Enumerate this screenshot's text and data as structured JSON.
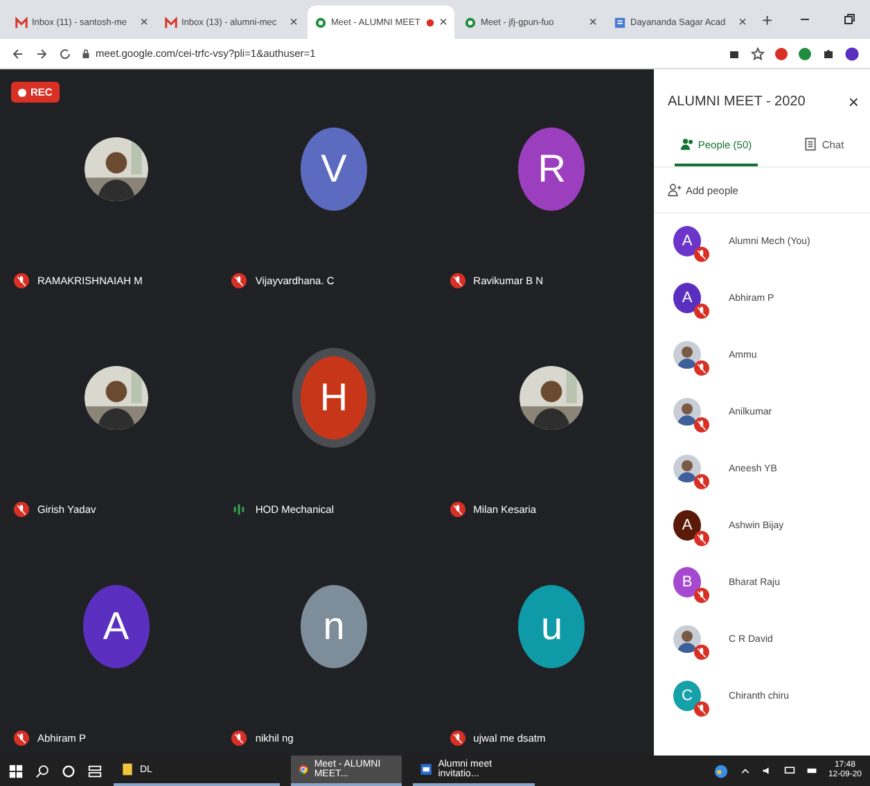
{
  "browser": {
    "tabs": [
      {
        "title": "Inbox (11) - santosh-me",
        "kind": "mail",
        "selected": false,
        "recording": false,
        "close": "×"
      },
      {
        "title": "Inbox (13) - alumni-mec",
        "kind": "mail",
        "selected": false,
        "recording": false,
        "close": "×"
      },
      {
        "title": "Meet - ALUMNI MEET",
        "kind": "meet",
        "selected": true,
        "recording": true,
        "close": "×"
      },
      {
        "title": "Meet - jfj-gpun-fuo",
        "kind": "meet",
        "selected": false,
        "recording": false,
        "close": "×"
      },
      {
        "title": "Dayananda Sagar Acad",
        "kind": "doc",
        "selected": false,
        "recording": false,
        "close": "×"
      }
    ],
    "new_tab": "+",
    "url": "meet.google.com/cei-trfc-vsy?pli=1&authuser=1"
  },
  "meeting": {
    "rec_label": "REC",
    "tiles": [
      {
        "name": "RAMAKRISHNAIAH M",
        "muted": true
      },
      {
        "name": "Vijayvardhana. C",
        "kind": "letter",
        "letter": "V",
        "color": "#5c6bc0",
        "muted": true
      },
      {
        "name": "Ravikumar B N",
        "kind": "letter",
        "letter": "R",
        "color": "#9c3fbf",
        "muted": true
      },
      {
        "name": "Girish Yadav",
        "muted": true
      },
      {
        "name": "HOD Mechanical",
        "kind": "letter",
        "letter": "H",
        "color": "#c8361a",
        "muted": false
      },
      {
        "name": "Milan Kesaria",
        "muted": true
      },
      {
        "name": "Abhiram P",
        "kind": "letter",
        "letter": "A",
        "color": "#5a2fc0",
        "muted": true
      },
      {
        "name": "nikhil ng",
        "kind": "letter",
        "letter": "n",
        "color": "#7d8d99",
        "muted": true
      },
      {
        "name": "ujwal me dsatm",
        "kind": "letter",
        "letter": "u",
        "color": "#0f9aa8",
        "muted": true
      }
    ]
  },
  "panel": {
    "title": "ALUMNI MEET - 2020",
    "close": "×",
    "tabs": [
      {
        "label": "People (50)",
        "kind": "people",
        "selected": true
      },
      {
        "label": "Chat",
        "kind": "chat",
        "selected": false
      }
    ],
    "add_people": "Add people",
    "people": [
      {
        "name": "Alumni Mech (You)",
        "kind": "letter",
        "letter": "A",
        "color": "#6a35c8"
      },
      {
        "name": "Abhiram P",
        "kind": "letter",
        "letter": "A",
        "color": "#5a2fc0"
      },
      {
        "name": "Ammu"
      },
      {
        "name": "Anilkumar"
      },
      {
        "name": "Aneesh YB"
      },
      {
        "name": "Ashwin Bijay",
        "kind": "letter",
        "letter": "A",
        "color": "#5a1a0a"
      },
      {
        "name": "Bharat Raju",
        "kind": "letter",
        "letter": "B",
        "color": "#a54ad0"
      },
      {
        "name": "C R David"
      },
      {
        "name": "Chiranth chiru",
        "kind": "letter",
        "letter": "C",
        "color": "#16a0a8"
      }
    ]
  },
  "taskbar": {
    "apps": [
      {
        "label": "DL",
        "kind": "folder"
      },
      {
        "label": "Meet - ALUMNI MEET...",
        "kind": "chrome"
      },
      {
        "label": "Alumni meet invitatio...",
        "kind": "doc"
      }
    ],
    "time": "17:48",
    "date": "12-09-20"
  }
}
